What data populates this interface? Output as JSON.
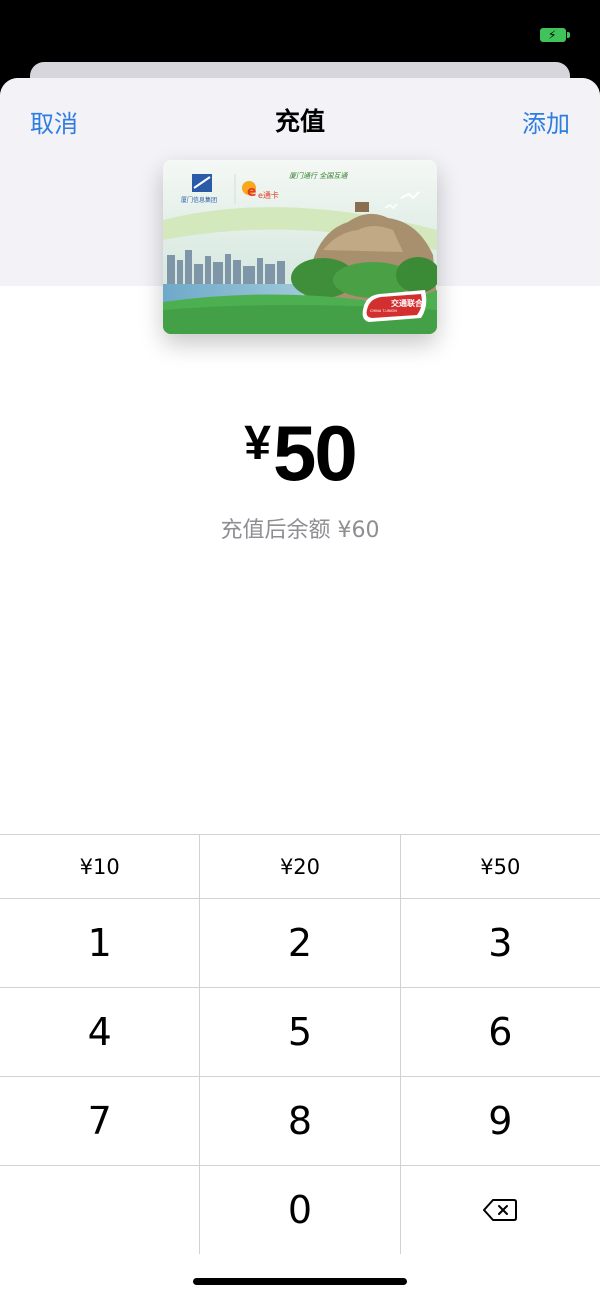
{
  "status_bar": {
    "battery_color": "#3fc35a"
  },
  "nav": {
    "cancel_label": "取消",
    "title": "充值",
    "add_label": "添加",
    "accent_color": "#2f7de1"
  },
  "card": {
    "issuer": "厦门信息集团",
    "brand": "e通卡",
    "slogan": "厦门通行 全国互通",
    "union_label": "交通联合",
    "union_en": "CHINA T-UNION"
  },
  "amount": {
    "currency": "¥",
    "value": "50"
  },
  "balance_text": "充值后余额 ¥60",
  "quick_amounts": [
    "¥10",
    "¥20",
    "¥50"
  ],
  "keys": {
    "row1": [
      "1",
      "2",
      "3"
    ],
    "row2": [
      "4",
      "5",
      "6"
    ],
    "row3": [
      "7",
      "8",
      "9"
    ],
    "row4": [
      "",
      "0",
      "delete"
    ]
  }
}
